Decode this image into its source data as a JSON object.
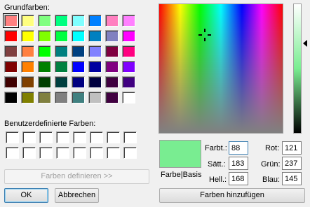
{
  "basic": {
    "label": "Grundfarben:",
    "colors": [
      "#ff8080",
      "#ffff80",
      "#80ff80",
      "#00ff80",
      "#80ffff",
      "#0080ff",
      "#ff80c0",
      "#ff80ff",
      "#ff0000",
      "#ffff00",
      "#80ff00",
      "#00ff40",
      "#00ffff",
      "#0080c0",
      "#8080c0",
      "#ff00ff",
      "#804040",
      "#ff8040",
      "#00ff00",
      "#008080",
      "#004080",
      "#8080ff",
      "#800040",
      "#ff0080",
      "#800000",
      "#ff8000",
      "#008000",
      "#008040",
      "#0000ff",
      "#0000a0",
      "#800080",
      "#8000ff",
      "#400000",
      "#804000",
      "#004000",
      "#004040",
      "#000080",
      "#000040",
      "#400040",
      "#400080",
      "#000000",
      "#808000",
      "#808040",
      "#808080",
      "#408080",
      "#c0c0c0",
      "#400040",
      "#ffffff"
    ]
  },
  "custom": {
    "label": "Benutzerdefinierte Farben:",
    "count": 16
  },
  "buttons": {
    "define": "Farben definieren >>",
    "ok": "OK",
    "cancel": "Abbrechen",
    "add": "Farben hinzufügen"
  },
  "preview": {
    "label": "Farbe|Basis",
    "color": "#79ed91"
  },
  "fields": {
    "hue": {
      "label": "Farbt.:",
      "value": "88"
    },
    "sat": {
      "label": "Sätt.:",
      "value": "183"
    },
    "lum": {
      "label": "Hell.:",
      "value": "168"
    },
    "red": {
      "label": "Rot:",
      "value": "121"
    },
    "green": {
      "label": "Grün:",
      "value": "237"
    },
    "blue": {
      "label": "Blau:",
      "value": "145"
    }
  }
}
